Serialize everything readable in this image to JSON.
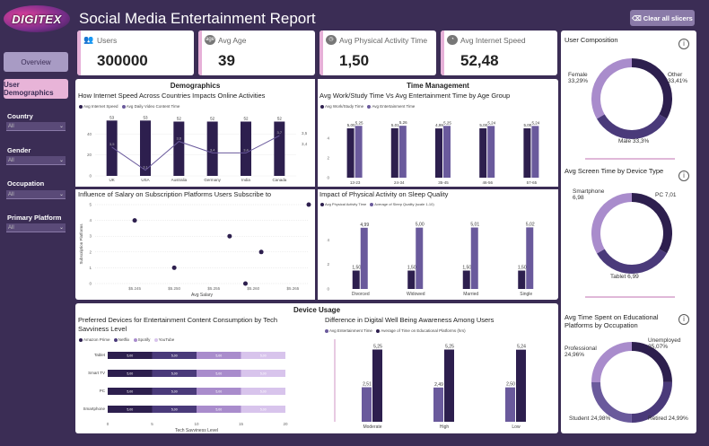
{
  "app": {
    "logo": "DIGITEX",
    "title": "Social Media Entertainment Report",
    "clear_label": "Clear all slicers"
  },
  "nav": [
    {
      "label": "Overview"
    },
    {
      "label": "User Demographics"
    }
  ],
  "filters": [
    {
      "label": "Country",
      "value": "All"
    },
    {
      "label": "Gender",
      "value": "All"
    },
    {
      "label": "Occupation",
      "value": "All"
    },
    {
      "label": "Primary Platform",
      "value": "All"
    }
  ],
  "kpis": [
    {
      "label": "Users",
      "value": "300000",
      "icon": "users-icon"
    },
    {
      "label": "Avg Age",
      "value": "39",
      "icon": "age-icon"
    },
    {
      "label": "Avg Physical Activity Time",
      "value": "1,50",
      "icon": "clock-icon"
    },
    {
      "label": "Avg Internet Speed",
      "value": "52,48",
      "icon": "speedometer-icon"
    }
  ],
  "sections": {
    "demographics": "Demographics",
    "time_management": "Time Management",
    "device_usage": "Device Usage"
  },
  "colors": {
    "dark": "#2d1f4e",
    "mid": "#6a5a9c",
    "light": "#a98ccc",
    "lighter": "#c8b0e0"
  },
  "charts": {
    "internet": {
      "title": "How Internet Speed Across Countries Impacts Online Activities",
      "legend": [
        "Avg Internet Speed",
        "Avg Daily Video Content Time"
      ]
    },
    "worktime": {
      "title": "Avg Work/Study Time Vs Avg Entertainment Time by Age Group",
      "legend": [
        "Avg Work/Study Time",
        "Avg Entertainment Time"
      ]
    },
    "salary": {
      "title": "Influence of Salary on Subscription Platforms Users Subscribe to",
      "xlabel": "Avg Salary",
      "ylabel": "Subscription Platforms"
    },
    "sleep": {
      "title": "Impact of Physical Activity on Sleep Quality",
      "legend": [
        "Avg Physical Activity Time",
        "Average of Sleep Quality (scale 1-10)"
      ]
    },
    "devices": {
      "title": "Preferred Devices for Entertainment Content Consumption by Tech Savviness Level",
      "legend": [
        "Amazon Prime",
        "Netflix",
        "Spotify",
        "YouTube"
      ],
      "xlabel": "Tech Savviness Level"
    },
    "wellbeing": {
      "title": "Difference in Digital Well Being Awareness Among Users",
      "legend": [
        "Avg Entertainment Time",
        "Average of Time on Educational Platforms (hrs)"
      ]
    },
    "composition": {
      "title": "User Composition",
      "labels": [
        "Female 33,29%",
        "Other 33,41%",
        "Male 33,3%"
      ]
    },
    "screen": {
      "title": "Avg Screen Time by Device Type",
      "labels": [
        "Smartphone 6,98",
        "PC 7,01",
        "Tablet 6,99"
      ]
    },
    "edu": {
      "title": "Avg Time Spent on Educational Platforms by Occupation",
      "labels": [
        "Professional 24,96%",
        "Unemployed 25,07%",
        "Student 24,98%",
        "Retired 24,99%"
      ]
    }
  },
  "chart_data": [
    {
      "type": "bar",
      "title": "How Internet Speed Across Countries Impacts Online Activities",
      "categories": [
        "UK",
        "USA",
        "Australia",
        "Germany",
        "India",
        "Canada"
      ],
      "series": [
        {
          "name": "Avg Internet Speed",
          "values": [
            53,
            53,
            52,
            52,
            52,
            52
          ]
        },
        {
          "name": "Avg Daily Video Content Time",
          "values": [
            3.5,
            3.1,
            3.6,
            3.4,
            3.4,
            3.7
          ]
        }
      ],
      "ylim": [
        0,
        55
      ],
      "y2lim": [
        3.0,
        4.0
      ],
      "y_ticks": [
        0,
        20,
        40
      ],
      "y2_ticks": [
        "3,5",
        "3,4"
      ]
    },
    {
      "type": "bar",
      "title": "Avg Work/Study Time Vs Avg Entertainment Time by Age Group",
      "categories": [
        "13-23",
        "24-34",
        "35-45",
        "46-56",
        "57-65"
      ],
      "series": [
        {
          "name": "Avg Work/Study Time",
          "values": [
            5.0,
            5.01,
            4.99,
            5.0,
            5.0
          ]
        },
        {
          "name": "Avg Entertainment Time",
          "values": [
            5.25,
            5.26,
            5.25,
            5.24,
            5.24
          ]
        }
      ],
      "ylim": [
        0,
        6
      ],
      "y_ticks": [
        0,
        2,
        4
      ]
    },
    {
      "type": "scatter",
      "title": "Influence of Salary on Subscription Platforms Users Subscribe to",
      "xlabel": "Avg Salary",
      "ylabel": "Subscription Platforms",
      "points": [
        {
          "x": 5245,
          "y": 4.0
        },
        {
          "x": 5250,
          "y": 1.0
        },
        {
          "x": 5257,
          "y": 3.0
        },
        {
          "x": 5259,
          "y": 0.0
        },
        {
          "x": 5261,
          "y": 2.0
        },
        {
          "x": 5267,
          "y": 5.0
        }
      ],
      "xlim": [
        5240,
        5267
      ],
      "ylim": [
        0,
        5
      ],
      "x_ticks": [
        "$5.245",
        "$5.250",
        "$5.255",
        "$5.260",
        "$5.265"
      ],
      "y_ticks": [
        0,
        1,
        2,
        3,
        4,
        5
      ]
    },
    {
      "type": "bar",
      "title": "Impact of Physical Activity on Sleep Quality",
      "categories": [
        "Divorced",
        "Widowed",
        "Married",
        "Single"
      ],
      "series": [
        {
          "name": "Avg Physical Activity Time",
          "values": [
            1.5,
            1.5,
            1.5,
            1.5
          ],
          "labels": [
            "1,50",
            "1,50",
            "1,50",
            "1,50"
          ]
        },
        {
          "name": "Average of Sleep Quality (scale 1-10)",
          "values": [
            4.99,
            5.0,
            5.01,
            5.02
          ],
          "labels": [
            "4,99",
            "5,00",
            "5,01",
            "5,02"
          ]
        }
      ],
      "ylim": [
        0,
        6
      ],
      "y_ticks": [
        0,
        2,
        4
      ]
    },
    {
      "type": "bar",
      "orientation": "horizontal-stacked",
      "title": "Preferred Devices for Entertainment Content Consumption by Tech Savviness Level",
      "xlabel": "Tech Savviness Level",
      "categories": [
        "Tablet",
        "Smart TV",
        "PC",
        "Smartphone"
      ],
      "series": [
        {
          "name": "Amazon Prime",
          "values": [
            5,
            5,
            5,
            5
          ]
        },
        {
          "name": "Netflix",
          "values": [
            5,
            5,
            5,
            5
          ]
        },
        {
          "name": "Spotify",
          "values": [
            5,
            5,
            5,
            5
          ]
        },
        {
          "name": "YouTube",
          "values": [
            5,
            5,
            5,
            5
          ]
        }
      ],
      "xlim": [
        0,
        20
      ],
      "x_ticks": [
        0,
        5,
        10,
        15,
        20
      ]
    },
    {
      "type": "bar",
      "title": "Difference in Digital Well Being Awareness Among Users",
      "categories": [
        "Moderate",
        "High",
        "Low"
      ],
      "series": [
        {
          "name": "Avg Entertainment Time",
          "values": [
            2.51,
            2.49,
            2.5
          ],
          "labels": [
            "2,51",
            "2,49",
            "2,50"
          ]
        },
        {
          "name": "Average of Time on Educational Platforms (hrs)",
          "values": [
            5.25,
            5.25,
            5.24
          ],
          "labels": [
            "5,25",
            "5,25",
            "5,24"
          ]
        }
      ],
      "ylim": [
        0,
        6
      ]
    },
    {
      "type": "pie",
      "title": "User Composition",
      "labels": [
        "Female",
        "Other",
        "Male"
      ],
      "values": [
        33.29,
        33.41,
        33.3
      ]
    },
    {
      "type": "pie",
      "title": "Avg Screen Time by Device Type",
      "labels": [
        "Smartphone",
        "PC",
        "Tablet"
      ],
      "values": [
        6.98,
        7.01,
        6.99
      ]
    },
    {
      "type": "pie",
      "title": "Avg Time Spent on Educational Platforms by Occupation",
      "labels": [
        "Professional",
        "Unemployed",
        "Retired",
        "Student"
      ],
      "values": [
        24.96,
        25.07,
        24.99,
        24.98
      ]
    }
  ]
}
